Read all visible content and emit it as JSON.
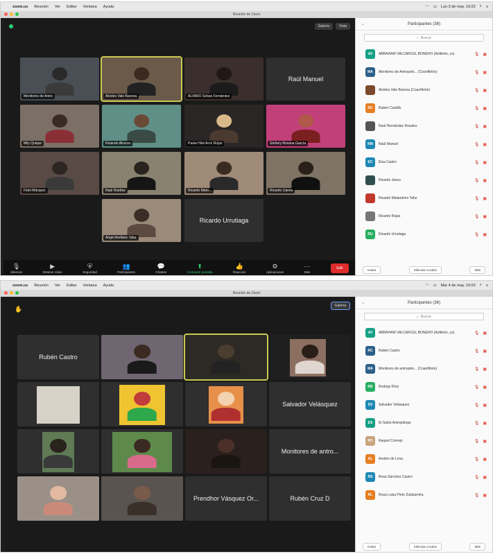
{
  "menubar": {
    "app": "zoom.us",
    "items": [
      "Reunión",
      "Ver",
      "Editar",
      "Ventana",
      "Ayuda"
    ],
    "clock_1": "Lun 3 de may. 10:22",
    "clock_2": "Mar 4 de may. 10:03"
  },
  "window_title": "Reunión de Zoom",
  "toolbar": {
    "mute": "Silenciar",
    "video": "Detener vídeo",
    "security": "Seguridad",
    "participants": "Participantes",
    "participants_count": "38",
    "chat": "Chatear",
    "share": "Compartir pantalla",
    "reactions": "Reacción",
    "apps": "Aplicaciones",
    "more": "Más",
    "end": "Salir"
  },
  "view_button_1": "Galería",
  "view_button_2": "Vista",
  "view_button_shot2": "Galería",
  "panel": {
    "title_1": "Participantes (38)",
    "title_2": "Participantes (36)",
    "search": "Buscar",
    "invite": "Invitar",
    "mute_all": "Silenciar a todos",
    "more": "Más"
  },
  "shot1": {
    "tiles": [
      {
        "name": "Monitores de Antro"
      },
      {
        "name": "Alcides Vale Barrera"
      },
      {
        "name": "ALVARO Sebas Fernández"
      },
      {
        "name": "Raúl Manuel"
      },
      {
        "name": "Mily Quispe"
      },
      {
        "name": "Rolando Alcocer"
      },
      {
        "name": "Paola Hilal Arce Rojas"
      },
      {
        "name": "Stefany Roxana García"
      },
      {
        "name": "Fidel Márquez"
      },
      {
        "name": "Raúl Ruidíaz"
      },
      {
        "name": "Ricardo Mato..."
      },
      {
        "name": "Ricardo Llanos"
      },
      {
        "name": "Ángel Arellano Tafur"
      },
      {
        "name": "Ricardo Urrutiaga"
      }
    ],
    "participants": [
      {
        "name": "ABRAHAM VALCÁRCEL BONEHO (Anfitrión, yo)",
        "av": "AV",
        "color": "#16a085"
      },
      {
        "name": "Monitores de Antropolo... (Coanfitrión)",
        "av": "MA",
        "color": "#2c5f8a"
      },
      {
        "name": "Alcides Vale Barrera (Coanfitrión)",
        "av": "",
        "color": "#7b4a2d"
      },
      {
        "name": "Rubén Castillo",
        "av": "RC",
        "color": "#e67e22"
      },
      {
        "name": "Raúl Hernández Rosales",
        "av": "",
        "color": "#555"
      },
      {
        "name": "Raúl Manuel",
        "av": "RM",
        "color": "#1e88b4"
      },
      {
        "name": "Elsa Castro",
        "av": "EC",
        "color": "#1e88b4"
      },
      {
        "name": "Ricardo Janco",
        "av": "",
        "color": "#2f4f4f"
      },
      {
        "name": "Ricardo Malandrino Tafur",
        "av": "",
        "color": "#c0392b"
      },
      {
        "name": "Ricardo Rojas",
        "av": "",
        "color": "#777"
      },
      {
        "name": "Ricardo Urrutiaga",
        "av": "RU",
        "color": "#27ae60"
      }
    ]
  },
  "shot2": {
    "tiles": [
      {
        "name": "Rubén Castro"
      },
      {
        "name": ""
      },
      {
        "name": ""
      },
      {
        "name": ""
      },
      {
        "name": ""
      },
      {
        "name": ""
      },
      {
        "name": ""
      },
      {
        "name": "Salvador Velásquez"
      },
      {
        "name": ""
      },
      {
        "name": ""
      },
      {
        "name": ""
      },
      {
        "name": "Monitores de antro..."
      },
      {
        "name": ""
      },
      {
        "name": ""
      },
      {
        "name": "Prendhor Vásquez Or..."
      },
      {
        "name": "Rubén Cruz D"
      }
    ],
    "participants": [
      {
        "name": "ABRAHAM VALCÁRCEL BONEHO (Anfitrión, yo)",
        "av": "AV",
        "color": "#16a085"
      },
      {
        "name": "Rubén Castro",
        "av": "RC",
        "color": "#2c5f8a"
      },
      {
        "name": "Monitores de antropolo... (Coanfitrión)",
        "av": "MA",
        "color": "#2c5f8a"
      },
      {
        "name": "Rodrigo Ríos",
        "av": "RR",
        "color": "#27ae60"
      },
      {
        "name": "Salvador Velásquez",
        "av": "SV",
        "color": "#1e88b4"
      },
      {
        "name": "El Sabio Antropólogo",
        "av": "ES",
        "color": "#16a085"
      },
      {
        "name": "Raquel Cornejo",
        "av": "RC",
        "color": "#c8a37c"
      },
      {
        "name": "Andrés de Lima",
        "av": "AL",
        "color": "#e67e22"
      },
      {
        "name": "Rosa Sánchez Castro",
        "av": "RS",
        "color": "#1e88b4"
      },
      {
        "name": "Rosa Luisa Pinto Zubizarreta",
        "av": "RL",
        "color": "#e67e22"
      }
    ]
  }
}
